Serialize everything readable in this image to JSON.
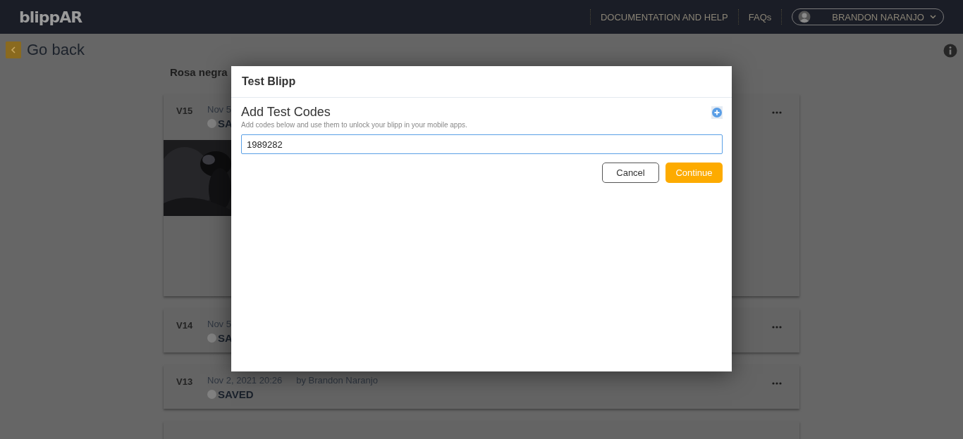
{
  "header": {
    "logo": "blippAR",
    "nav": [
      "DOCUMENTATION AND HELP",
      "FAQs"
    ],
    "user": "BRANDON NARANJO"
  },
  "back": {
    "label": "Go back"
  },
  "project": {
    "title": "Rosa negra"
  },
  "versions": [
    {
      "version": "V15",
      "date": "Nov 5",
      "status": "SA"
    },
    {
      "version": "V14",
      "date": "Nov 5",
      "status": "SA",
      "kind": "plain"
    },
    {
      "version": "V13",
      "date": "Nov 2, 2021 20:26",
      "author": "by Brandon Naranjo",
      "status": "SAVED",
      "kind": "plain"
    },
    {
      "kind": "empty"
    }
  ],
  "dialog": {
    "title": "Test Blipp",
    "heading": "Add Test Codes",
    "hint": "Add codes below and use them to unlock your blipp in your mobile apps.",
    "code": "1989282",
    "buttons": [
      {
        "label": "Cancel",
        "kind": "secondary"
      },
      {
        "label": "Continue",
        "kind": "primary"
      }
    ]
  }
}
